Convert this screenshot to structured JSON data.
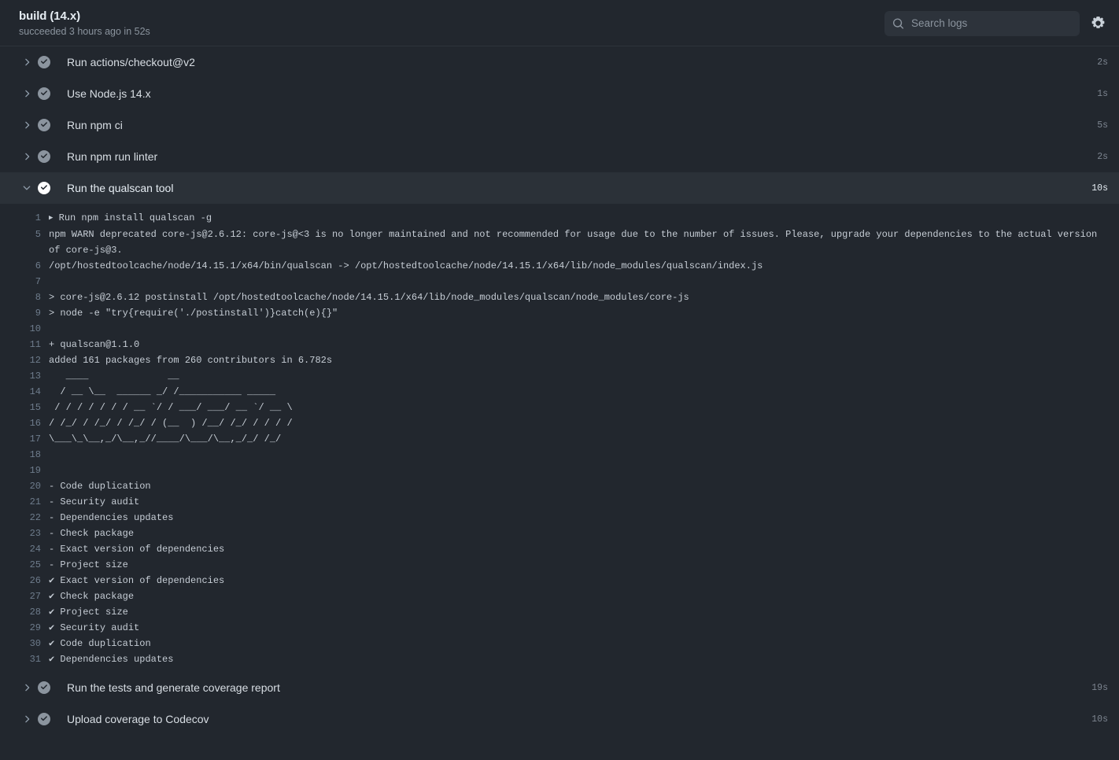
{
  "header": {
    "title": "build (14.x)",
    "subtitle": "succeeded 3 hours ago in 52s",
    "search_placeholder": "Search logs",
    "search_value": "",
    "settings_label": "Settings"
  },
  "steps": [
    {
      "label": "Run actions/checkout@v2",
      "time": "2s",
      "status": "success",
      "expanded": false
    },
    {
      "label": "Use Node.js 14.x",
      "time": "1s",
      "status": "success",
      "expanded": false
    },
    {
      "label": "Run npm ci",
      "time": "5s",
      "status": "success",
      "expanded": false
    },
    {
      "label": "Run npm run linter",
      "time": "2s",
      "status": "success",
      "expanded": false
    },
    {
      "label": "Run the qualscan tool",
      "time": "10s",
      "status": "success",
      "expanded": true
    }
  ],
  "steps_after": [
    {
      "label": "Run the tests and generate coverage report",
      "time": "19s",
      "status": "success",
      "expanded": false
    },
    {
      "label": "Upload coverage to Codecov",
      "time": "10s",
      "status": "success",
      "expanded": false
    }
  ],
  "log": [
    {
      "n": "1",
      "text": "Run npm install qualscan -g",
      "marker": true
    },
    {
      "n": "5",
      "text": "npm WARN deprecated core-js@2.6.12: core-js@<3 is no longer maintained and not recommended for usage due to the number of issues. Please, upgrade your dependencies to the actual version of core-js@3."
    },
    {
      "n": "6",
      "text": "/opt/hostedtoolcache/node/14.15.1/x64/bin/qualscan -> /opt/hostedtoolcache/node/14.15.1/x64/lib/node_modules/qualscan/index.js"
    },
    {
      "n": "7",
      "text": ""
    },
    {
      "n": "8",
      "text": "> core-js@2.6.12 postinstall /opt/hostedtoolcache/node/14.15.1/x64/lib/node_modules/qualscan/node_modules/core-js"
    },
    {
      "n": "9",
      "text": "> node -e \"try{require('./postinstall')}catch(e){}\""
    },
    {
      "n": "10",
      "text": ""
    },
    {
      "n": "11",
      "text": "+ qualscan@1.1.0"
    },
    {
      "n": "12",
      "text": "added 161 packages from 260 contributors in 6.782s"
    },
    {
      "n": "13",
      "text": "   ____              __",
      "ascii": true
    },
    {
      "n": "14",
      "text": "  / __ \\__  ______ _/ /___________ _____",
      "ascii": true
    },
    {
      "n": "15",
      "text": " / / / / / / / __ `/ / ___/ ___/ __ `/ __ \\",
      "ascii": true
    },
    {
      "n": "16",
      "text": "/ /_/ / /_/ / /_/ / (__  ) /__/ /_/ / / / /",
      "ascii": true
    },
    {
      "n": "17",
      "text": "\\___\\_\\__,_/\\__,_//____/\\___/\\__,_/_/ /_/",
      "ascii": true
    },
    {
      "n": "18",
      "text": ""
    },
    {
      "n": "19",
      "text": ""
    },
    {
      "n": "20",
      "text": "- Code duplication"
    },
    {
      "n": "21",
      "text": "- Security audit"
    },
    {
      "n": "22",
      "text": "- Dependencies updates"
    },
    {
      "n": "23",
      "text": "- Check package"
    },
    {
      "n": "24",
      "text": "- Exact version of dependencies"
    },
    {
      "n": "25",
      "text": "- Project size"
    },
    {
      "n": "26",
      "text": "✔ Exact version of dependencies"
    },
    {
      "n": "27",
      "text": "✔ Check package"
    },
    {
      "n": "28",
      "text": "✔ Project size"
    },
    {
      "n": "29",
      "text": "✔ Security audit"
    },
    {
      "n": "30",
      "text": "✔ Code duplication"
    },
    {
      "n": "31",
      "text": "✔ Dependencies updates"
    }
  ],
  "colors": {
    "page_bg": "#22272e",
    "row_highlight": "#2b3138",
    "text_primary": "#e6edf3",
    "text_muted": "#8b949e",
    "line_number": "#6e7c8c",
    "status_success": "#8b949e",
    "status_success_active": "#ffffff"
  }
}
